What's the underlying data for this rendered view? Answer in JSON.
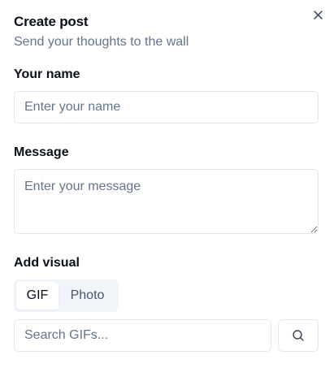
{
  "dialog": {
    "title": "Create post",
    "subtitle": "Send your thoughts to the wall",
    "close_icon": "close-icon"
  },
  "form": {
    "name_label": "Your name",
    "name_value": "",
    "name_placeholder": "Enter your name",
    "message_label": "Message",
    "message_value": "",
    "message_placeholder": "Enter your message",
    "visual_label": "Add visual",
    "visual_tabs": [
      {
        "label": "GIF",
        "active": true
      },
      {
        "label": "Photo",
        "active": false
      }
    ],
    "search_value": "",
    "search_placeholder": "Search GIFs...",
    "search_icon": "search-icon"
  },
  "colors": {
    "text": "#0b0f19",
    "muted": "#64748b",
    "border": "#e2e8f0",
    "toggle_bg": "#f1f5f9"
  }
}
